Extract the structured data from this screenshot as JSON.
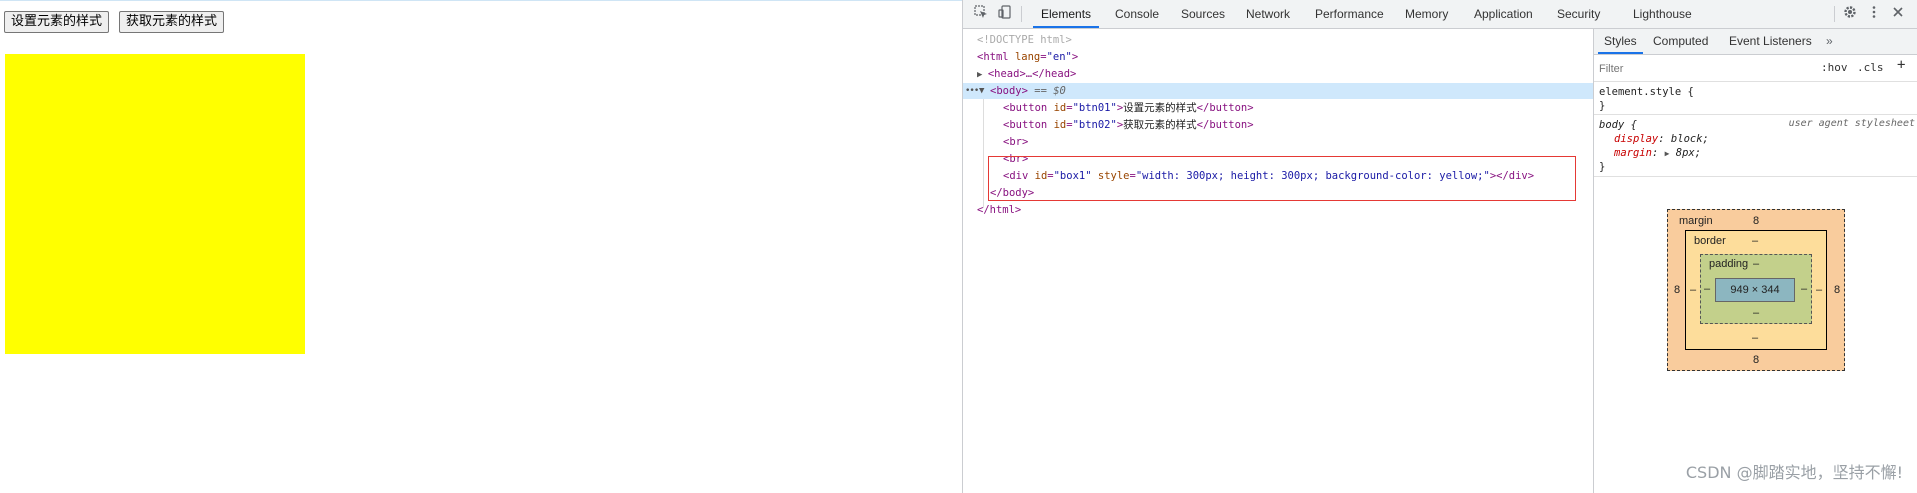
{
  "page": {
    "buttons": [
      {
        "id": "btn01",
        "label": "设置元素的样式"
      },
      {
        "id": "btn02",
        "label": "获取元素的样式"
      }
    ],
    "box_color": "#ffff00"
  },
  "devtools": {
    "tabs": [
      "Elements",
      "Console",
      "Sources",
      "Network",
      "Performance",
      "Memory",
      "Application",
      "Security",
      "Lighthouse"
    ],
    "active_tab": "Elements",
    "more_tabs_icon": "chevron-double-right-icon",
    "toolbar_icons": [
      "inspect-element-icon",
      "device-toolbar-icon",
      "gear-icon",
      "kebab-menu-icon",
      "close-icon"
    ],
    "dom": {
      "doctype": "<!DOCTYPE html>",
      "html_open_tag": "<html",
      "html_lang_attr": "lang",
      "html_lang_val": "\"en\"",
      "head_collapsed": "<head>…</head>",
      "body_open": "<body>",
      "body_marker": "== $0",
      "btn1_tag": "<button",
      "btn1_attr": "id",
      "btn1_val": "\"btn01\"",
      "btn1_text": "设置元素的样式",
      "btn2_tag": "<button",
      "btn2_attr": "id",
      "btn2_val": "\"btn02\"",
      "btn2_text": "获取元素的样式",
      "button_close": "</button>",
      "br": "<br>",
      "div_tag": "<div",
      "div_id_attr": "id",
      "div_id_val": "\"box1\"",
      "div_style_attr": "style",
      "div_style_val": "\"width: 300px; height: 300px; background-color: yellow;\"",
      "div_close": "></div>",
      "body_close": "</body>",
      "html_close": "</html>"
    },
    "styles": {
      "tabs": [
        "Styles",
        "Computed",
        "Event Listeners"
      ],
      "active_tab": "Styles",
      "more_icon": "chevron-double-right-icon",
      "filter_placeholder": "Filter",
      "hov_label": ":hov",
      "cls_label": ".cls",
      "add_rule_label": "+",
      "element_style_selector": "element.style {",
      "close_brace": "}",
      "body_selector": "body {",
      "body_source": "user agent stylesheet",
      "rules": [
        {
          "prop": "display",
          "value": "block;"
        },
        {
          "prop": "margin",
          "value": "8px;"
        }
      ]
    },
    "box_model": {
      "margin_label": "margin",
      "margin_top": "8",
      "margin_bottom": "8",
      "margin_left": "8",
      "margin_right": "8",
      "border_label": "border",
      "border_val": "–",
      "padding_label": "padding",
      "padding_val": "–",
      "content_size": "949 × 344"
    }
  },
  "watermark": "CSDN @脚踏实地，坚持不懈!"
}
